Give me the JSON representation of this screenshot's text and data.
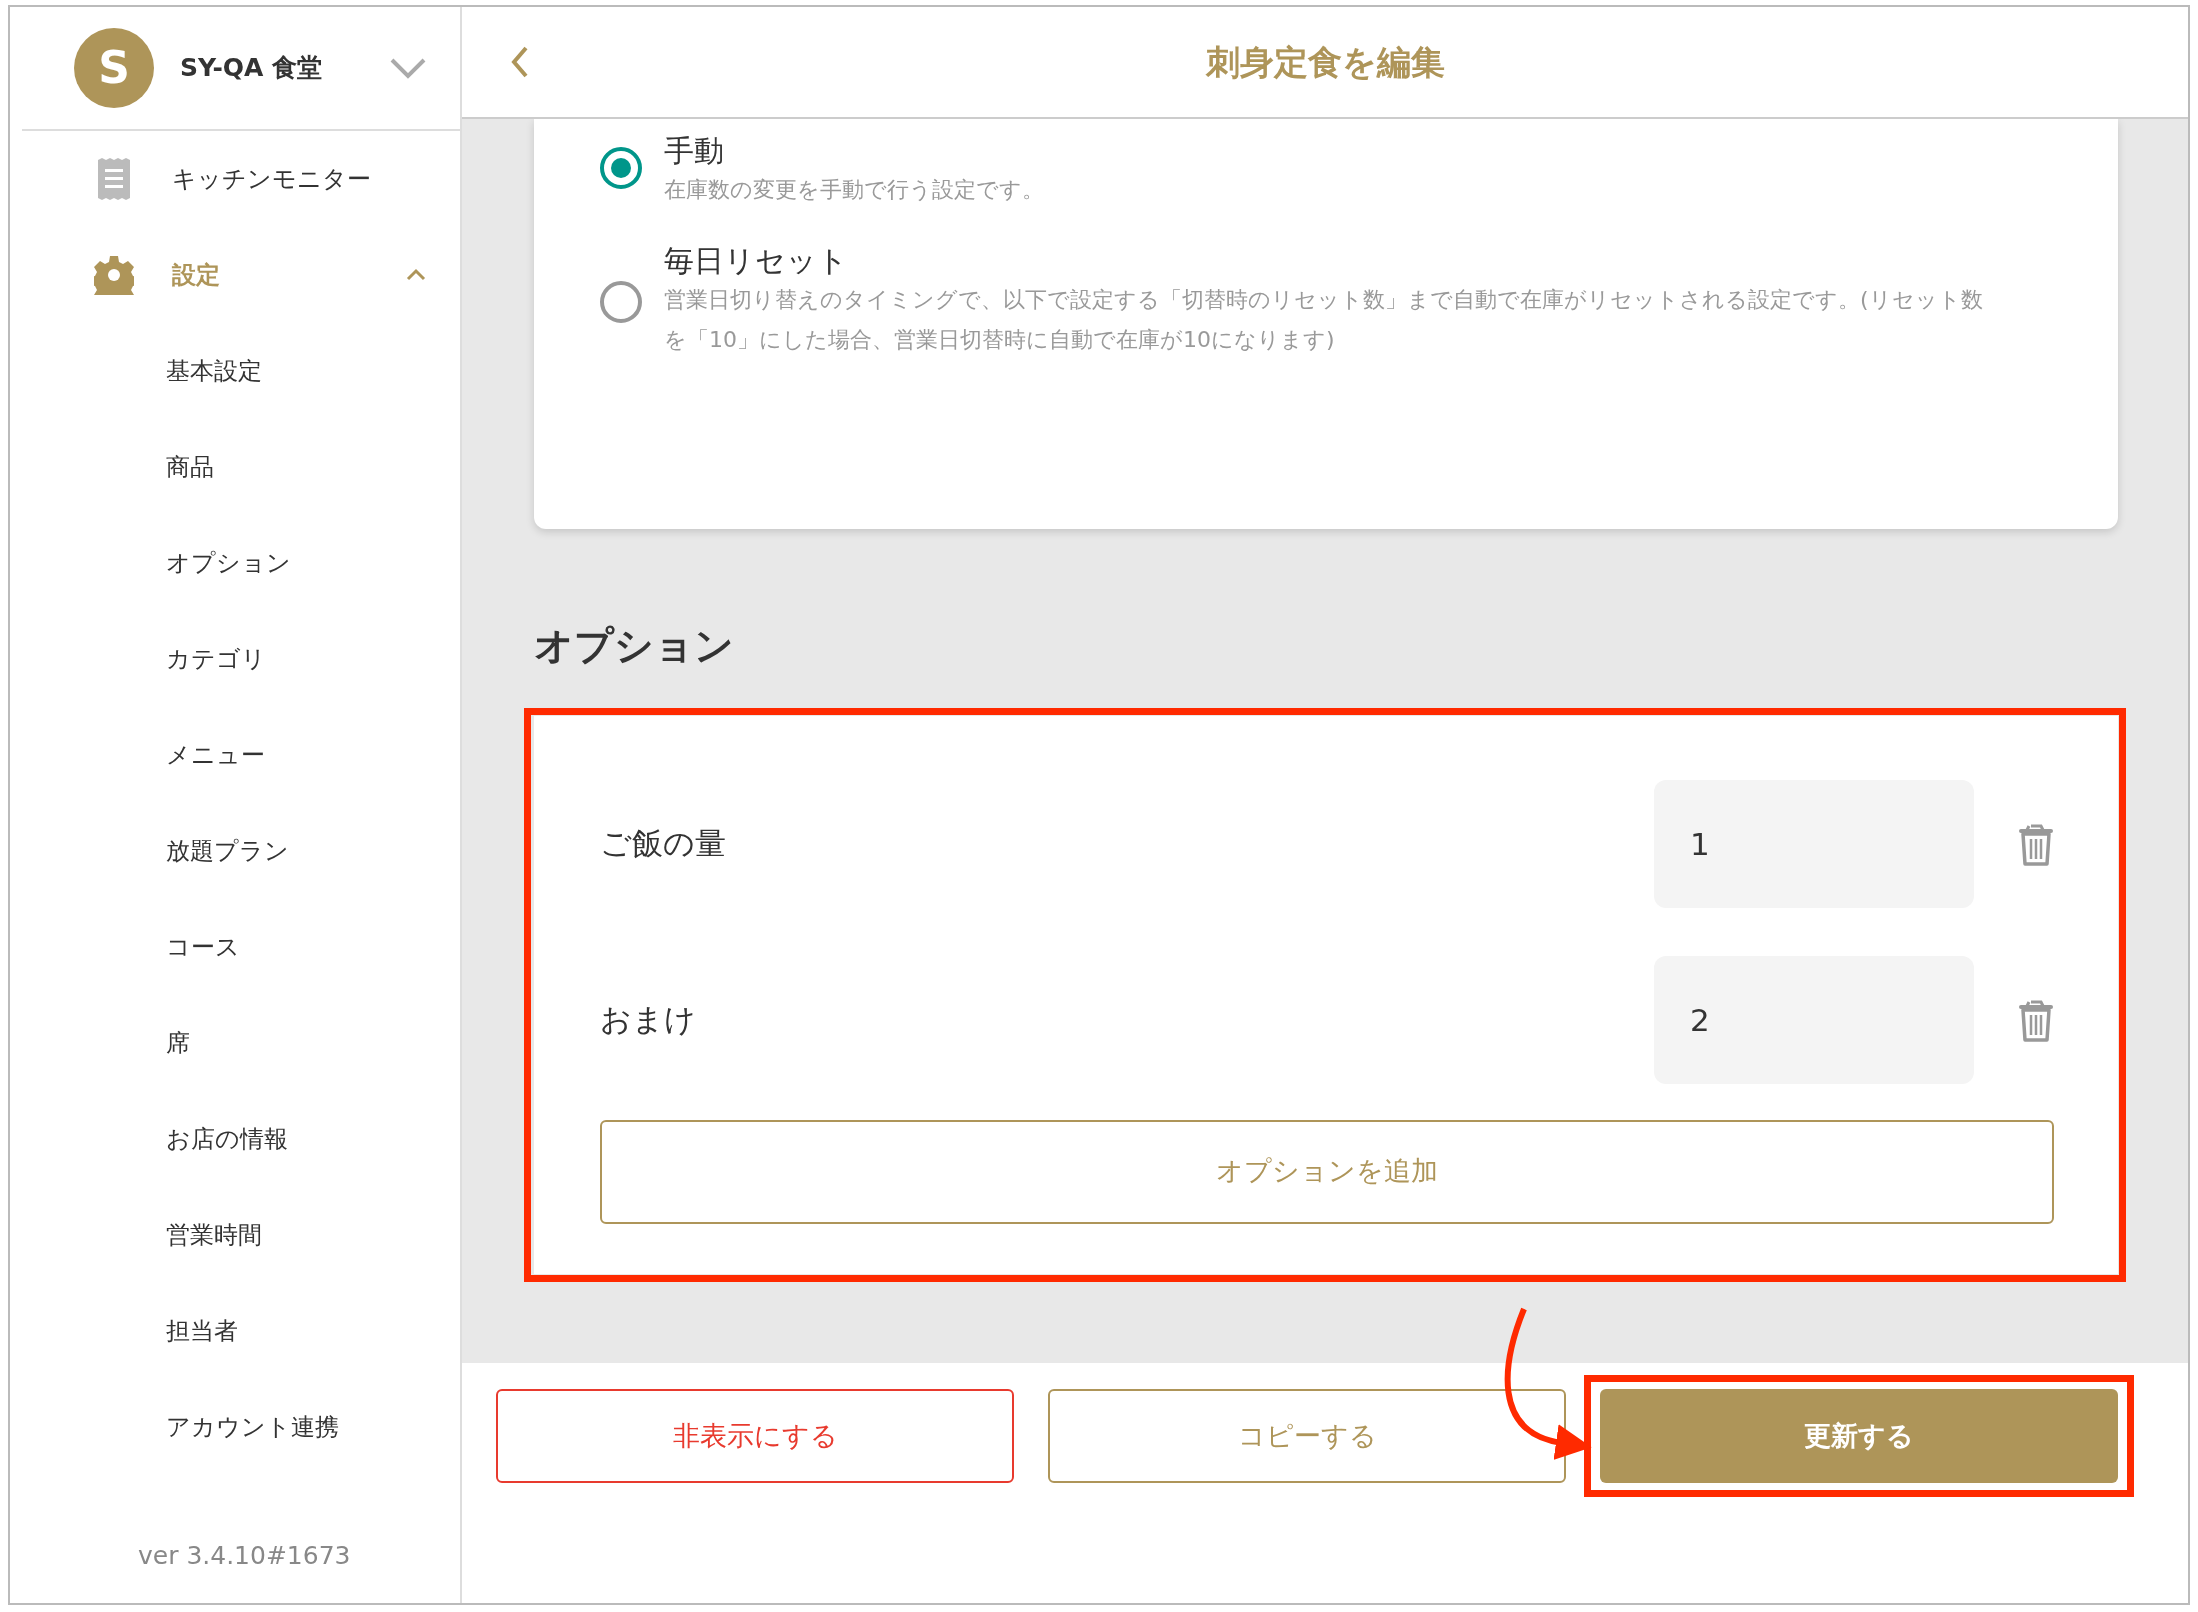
{
  "sidebar": {
    "store": {
      "avatar": "S",
      "name": "SY-QA 食堂",
      "expanded": false
    },
    "items": [
      {
        "kind": "monitor",
        "label": "キッチンモニター",
        "selected": false
      },
      {
        "kind": "settings",
        "label": "設定",
        "selected": true,
        "expanded": true,
        "children": [
          {
            "label": "基本設定",
            "selected": false
          },
          {
            "label": "商品",
            "selected": false
          },
          {
            "label": "オプション",
            "selected": false
          },
          {
            "label": "カテゴリ",
            "selected": false
          },
          {
            "label": "メニュー",
            "selected": false
          },
          {
            "label": "放題プラン",
            "selected": false
          },
          {
            "label": "コース",
            "selected": false
          },
          {
            "label": "席",
            "selected": false
          },
          {
            "label": "お店の情報",
            "selected": false
          },
          {
            "label": "営業時間",
            "selected": false
          },
          {
            "label": "担当者",
            "selected": false
          },
          {
            "label": "アカウント連携",
            "selected": false
          }
        ]
      }
    ],
    "version": "ver 3.4.10#1673"
  },
  "header": {
    "title": "刺身定食を編集"
  },
  "stock_modes": [
    {
      "label": "手動",
      "description": "在庫数の変更を手動で行う設定です。",
      "selected": true
    },
    {
      "label": "毎日リセット",
      "description": "営業日切り替えのタイミングで、以下で設定する「切替時のリセット数」まで自動で在庫がリセットされる設定です。(リセット数を「10」にした場合、営業日切替時に自動で在庫が10になります)",
      "selected": false
    }
  ],
  "options": {
    "heading": "オプション",
    "items": [
      {
        "name": "ご飯の量",
        "value": "1"
      },
      {
        "name": "おまけ",
        "value": "2"
      }
    ],
    "add_button": "オプションを追加"
  },
  "actions": [
    {
      "kind": "danger",
      "label": "非表示にする"
    },
    {
      "kind": "secondary",
      "label": "コピーする"
    },
    {
      "kind": "primary",
      "label": "更新する"
    }
  ]
}
